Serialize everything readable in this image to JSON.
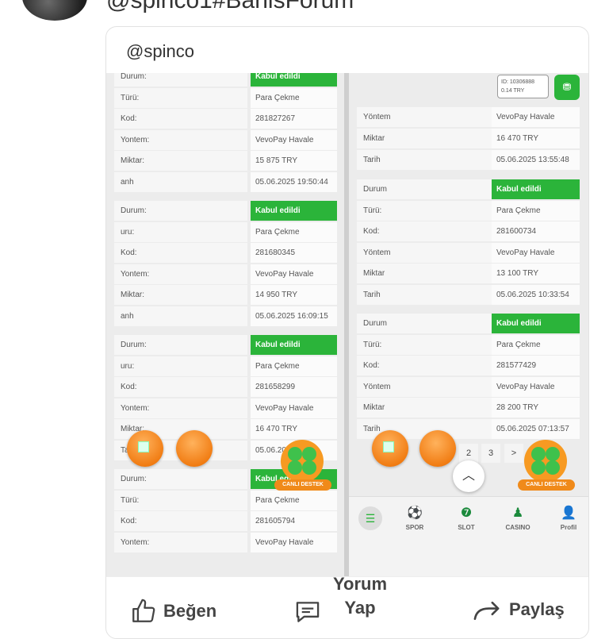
{
  "post": {
    "handle": "@spinco1#BahisForum"
  },
  "card": {
    "handle": "@spinco"
  },
  "left_rows": [
    {
      "k": "Durum:",
      "v": "Kabul edildi",
      "green": true
    },
    {
      "k": "Türü:",
      "v": "Para Çekme"
    },
    {
      "k": "Kod:",
      "v": "281827267"
    },
    {
      "k": "Yontem:",
      "v": "VevoPay Havale"
    },
    {
      "k": "Miktar:",
      "v": "15 875 TRY"
    },
    {
      "k": "anh",
      "v": "05.06.2025 19:50:44"
    },
    {
      "k": "Durum:",
      "v": "Kabul edildi",
      "green": true
    },
    {
      "k": "uru:",
      "v": "Para Çekme"
    },
    {
      "k": "Kod:",
      "v": "281680345"
    },
    {
      "k": "Yontem:",
      "v": "VevoPay Havale"
    },
    {
      "k": "Miktar:",
      "v": "14 950 TRY"
    },
    {
      "k": "anh",
      "v": "05.06.2025 16:09:15"
    },
    {
      "k": "Durum:",
      "v": "Kabul edildi",
      "green": true
    },
    {
      "k": "uru:",
      "v": "Para Çekme"
    },
    {
      "k": "Kod:",
      "v": "281658299"
    },
    {
      "k": "Yontem:",
      "v": "VevoPay Havale"
    },
    {
      "k": "Miktar:",
      "v": "16 470 TRY"
    },
    {
      "k": "Tar",
      "v": "05.06.20"
    },
    {
      "k": "Durum:",
      "v": "Kabul edildi",
      "green": true
    },
    {
      "k": "Türü:",
      "v": "Para Çekme"
    },
    {
      "k": "Kod:",
      "v": "281605794"
    },
    {
      "k": "Yontem:",
      "v": "VevoPay Havale"
    }
  ],
  "right_top": {
    "id_line1": "ID: 10306888",
    "id_line2": "0.14 TRY"
  },
  "right_rows": [
    {
      "k": "Yöntem",
      "v": "VevoPay Havale"
    },
    {
      "k": "Miktar",
      "v": "16 470 TRY"
    },
    {
      "k": "Tarih",
      "v": "05.06.2025 13:55:48"
    },
    {
      "k": "Durum",
      "v": "Kabul edildi",
      "green": true
    },
    {
      "k": "Türü:",
      "v": "Para Çekme"
    },
    {
      "k": "Kod:",
      "v": "281600734"
    },
    {
      "k": "Yöntem",
      "v": "VevoPay Havale"
    },
    {
      "k": "Miktar",
      "v": "13 100 TRY"
    },
    {
      "k": "Tarih",
      "v": "05.06.2025 10:33:54"
    },
    {
      "k": "Durum",
      "v": "Kabul edildi",
      "green": true
    },
    {
      "k": "Türü:",
      "v": "Para Çekme"
    },
    {
      "k": "Kod:",
      "v": "281577429"
    },
    {
      "k": "Yöntem",
      "v": "VevoPay Havale"
    },
    {
      "k": "Miktar",
      "v": "28 200 TRY"
    },
    {
      "k": "Tarih",
      "v": "05.06.2025 07:13:57"
    }
  ],
  "pager": [
    "2",
    "3",
    ">"
  ],
  "support_label": "CANLI DESTEK",
  "nav": [
    {
      "label": "SPOR",
      "icon": "soccer-ball-icon",
      "glyph": "⚽"
    },
    {
      "label": "SLOT",
      "icon": "slot-seven-icon",
      "glyph": "❼"
    },
    {
      "label": "CASINO",
      "icon": "chess-piece-icon",
      "glyph": "♟"
    },
    {
      "label": "Profil",
      "icon": "user-icon",
      "glyph": "👤"
    }
  ],
  "actions": {
    "like": "Beğen",
    "comment": "Yorum Yap",
    "share": "Paylaş"
  },
  "colors": {
    "green": "#2bb43a",
    "orange": "#f07a10"
  }
}
